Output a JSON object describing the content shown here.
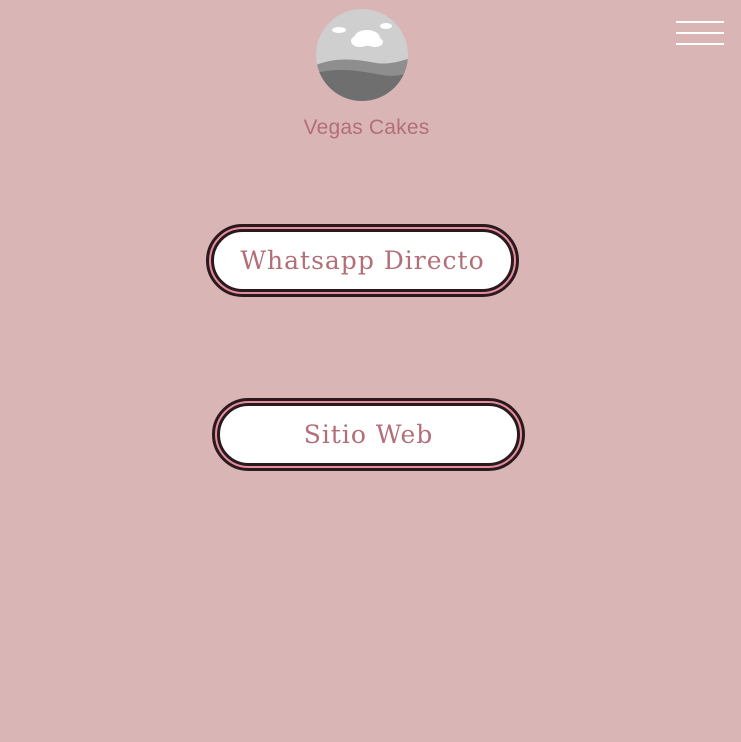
{
  "profile": {
    "name": "Vegas Cakes",
    "avatar_icon": "landscape-placeholder-icon"
  },
  "menu": {
    "icon": "hamburger-menu-icon"
  },
  "links": [
    {
      "label": "Whatsapp Directo"
    },
    {
      "label": "Sitio Web"
    }
  ],
  "colors": {
    "background": "#d9b5b5",
    "accent_text": "#b36f77",
    "button_fill": "#ffffff",
    "button_border": "#2a1a1d",
    "button_ring": "#e48ea0"
  }
}
